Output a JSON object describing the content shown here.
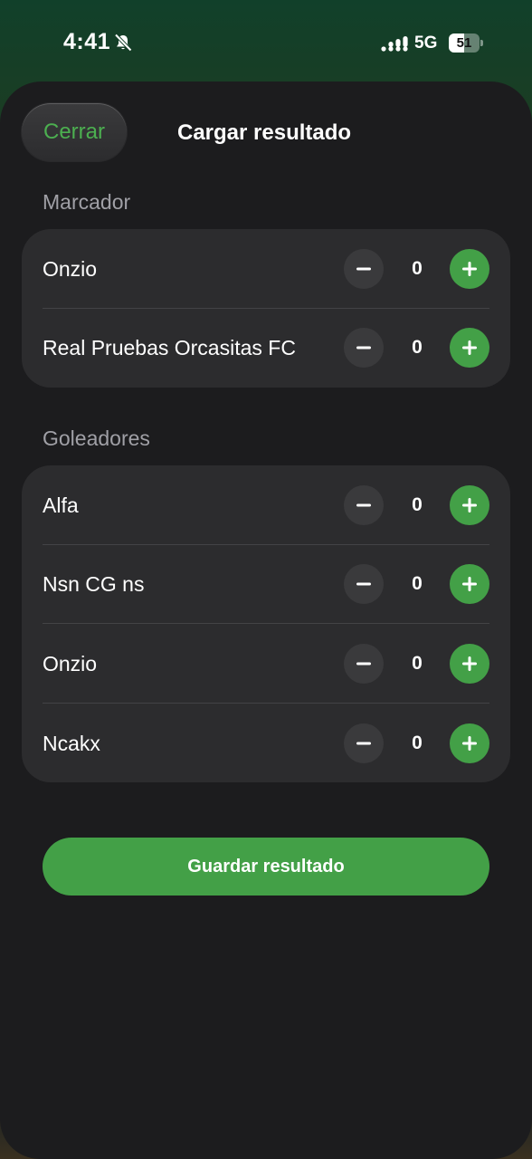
{
  "status_bar": {
    "time": "4:41",
    "network": "5G",
    "battery_level": "51",
    "battery_fraction": 0.51
  },
  "header": {
    "close_label": "Cerrar",
    "title": "Cargar resultado"
  },
  "scoreboard": {
    "label": "Marcador",
    "teams": [
      {
        "name": "Onzio",
        "score": "0"
      },
      {
        "name": "Real Pruebas Orcasitas FC",
        "score": "0"
      }
    ]
  },
  "scorers": {
    "label": "Goleadores",
    "players": [
      {
        "name": "Alfa",
        "goals": "0"
      },
      {
        "name": "Nsn CG ns",
        "goals": "0"
      },
      {
        "name": "Onzio",
        "goals": "0"
      },
      {
        "name": "Ncakx",
        "goals": "0"
      }
    ]
  },
  "save_label": "Guardar resultado",
  "colors": {
    "accent": "#43a047",
    "sheet": "#1c1c1e",
    "card": "#2c2c2e"
  },
  "icons": [
    "bell-slash-icon",
    "signal-icon",
    "battery-icon",
    "minus-icon",
    "plus-icon"
  ]
}
